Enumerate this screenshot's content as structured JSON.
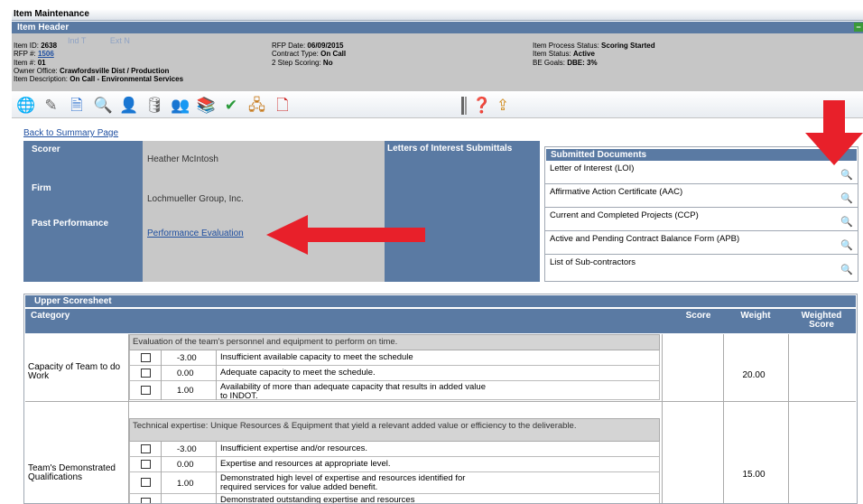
{
  "window": {
    "title": "Item Maintenance"
  },
  "item_header": {
    "label": "Item Header",
    "collapse": "−",
    "ghost_tabs": [
      "Ind T",
      "Ext N"
    ],
    "col1": [
      {
        "k": "Item ID: ",
        "v": "2638"
      },
      {
        "k": "RFP #: ",
        "v": "1506"
      },
      {
        "k": "Item #: ",
        "v": "01"
      },
      {
        "k": "Owner Office: ",
        "v": "Crawfordsville Dist / Production"
      },
      {
        "k": "Item Description: ",
        "v": "On Call - Environmental Services"
      }
    ],
    "col2": [
      {
        "k": "RFP Date: ",
        "v": "06/09/2015"
      },
      {
        "k": "Contract Type: ",
        "v": "On Call"
      },
      {
        "k": "2 Step Scoring: ",
        "v": "No"
      }
    ],
    "col3": [
      {
        "k": "Item Process Status: ",
        "v": "Scoring Started"
      },
      {
        "k": "Item Status: ",
        "v": "Active"
      },
      {
        "k": "BE Goals: ",
        "v": "DBE: 3%"
      }
    ]
  },
  "toolbar": {
    "icons": [
      "globe-icon",
      "pencil-icon",
      "document-icon",
      "magnifier-icon",
      "user-icon",
      "database-icon",
      "users-icon",
      "books-icon",
      "checkmark-icon",
      "org-chart-icon",
      "pdf-icon"
    ],
    "glyphs": [
      "🌐",
      "✎",
      "🗎",
      "🔍",
      "👤",
      "🛢",
      "👥",
      "📚",
      "✔",
      "🖧",
      "🗋"
    ],
    "right_icons": [
      "help-icon",
      "upload-icon"
    ],
    "right_glyphs": [
      "❓",
      "⇪"
    ]
  },
  "back_link": "Back to Summary Page",
  "scorer": {
    "scorer_label": "Scorer",
    "scorer_value": "Heather McIntosh",
    "firm_label": "Firm",
    "firm_value": "Lochmueller Group, Inc.",
    "past_label": "Past Performance",
    "past_link": "Performance Evaluation"
  },
  "letters": {
    "title": "Letters of Interest Submittals"
  },
  "submitted_docs": {
    "title": "Submitted Documents",
    "items": [
      "Letter of Interest (LOI)",
      "Affirmative Action Certificate (AAC)",
      "Current and Completed Projects (CCP)",
      "Active and Pending Contract Balance Form (APB)",
      "List of Sub-contractors"
    ],
    "search_glyph": "🔍"
  },
  "scoresheet": {
    "title": "Upper Scoresheet",
    "columns": {
      "category": "Category",
      "score": "Score",
      "weight": "Weight",
      "weighted_score_1": "Weighted",
      "weighted_score_2": "Score"
    },
    "sections": [
      {
        "category": "Capacity of Team to do Work",
        "description": "Evaluation of the team's personnel and equipment to perform on time.",
        "weight": "20.00",
        "options": [
          {
            "value": "-3.00",
            "text": "Insufficient available capacity to meet the schedule"
          },
          {
            "value": "0.00",
            "text": "Adequate capacity to meet the schedule."
          },
          {
            "value": "1.00",
            "text": "Availability of more than adequate capacity that results in added value to INDOT."
          }
        ]
      },
      {
        "category": "Team's Demonstrated Qualifications",
        "description": "Technical expertise: Unique Resources & Equipment that yield a relevant added value or efficiency to the deliverable.",
        "weight": "15.00",
        "options": [
          {
            "value": "-3.00",
            "text": "Insufficient expertise and/or resources."
          },
          {
            "value": "0.00",
            "text": "Expertise and resources at appropriate level."
          },
          {
            "value": "1.00",
            "text": "Demonstrated high level of expertise and resources identified for required services for value added benefit."
          },
          {
            "value": "",
            "text": "Demonstrated outstanding expertise and resources"
          }
        ]
      }
    ]
  },
  "colors": {
    "header_blue": "#5a7aa3",
    "panel_gray": "#c8c8c8",
    "arrow_red": "#e8202a"
  }
}
